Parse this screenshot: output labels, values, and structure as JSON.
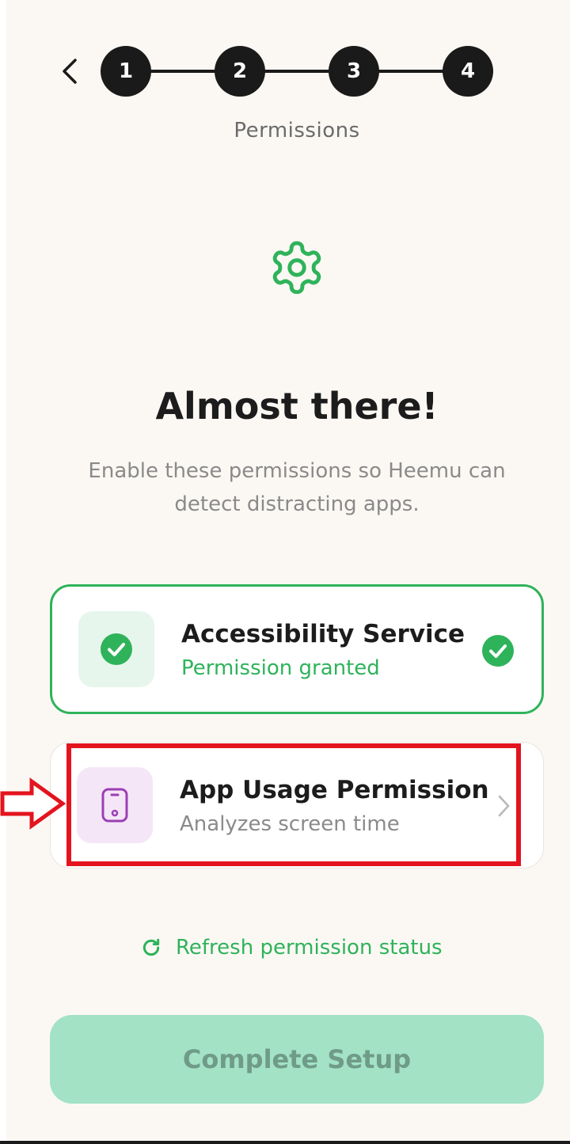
{
  "stepper": {
    "steps": [
      "1",
      "2",
      "3",
      "4"
    ],
    "caption": "Permissions"
  },
  "headline": "Almost there!",
  "subtext": "Enable these permissions so Heemu can detect distracting apps.",
  "permissions": [
    {
      "title": "Accessibility Service",
      "status": "Permission granted",
      "granted": true
    },
    {
      "title": "App Usage Permission",
      "status": "Analyzes screen time",
      "granted": false
    }
  ],
  "refresh_label": "Refresh permission status",
  "complete_button": "Complete Setup",
  "colors": {
    "accent_green": "#2fb35a",
    "background": "#fbf8f4",
    "step_dark": "#1a1a1a",
    "button_disabled": "#a3e2c5",
    "purple_icon": "#9b3fb5",
    "annotation_red": "#e3141e"
  },
  "icons": {
    "back": "chevron-left-icon",
    "header": "gear-icon",
    "granted": "check-circle-icon",
    "app_usage": "phone-icon",
    "open": "chevron-right-icon",
    "refresh": "refresh-icon"
  }
}
